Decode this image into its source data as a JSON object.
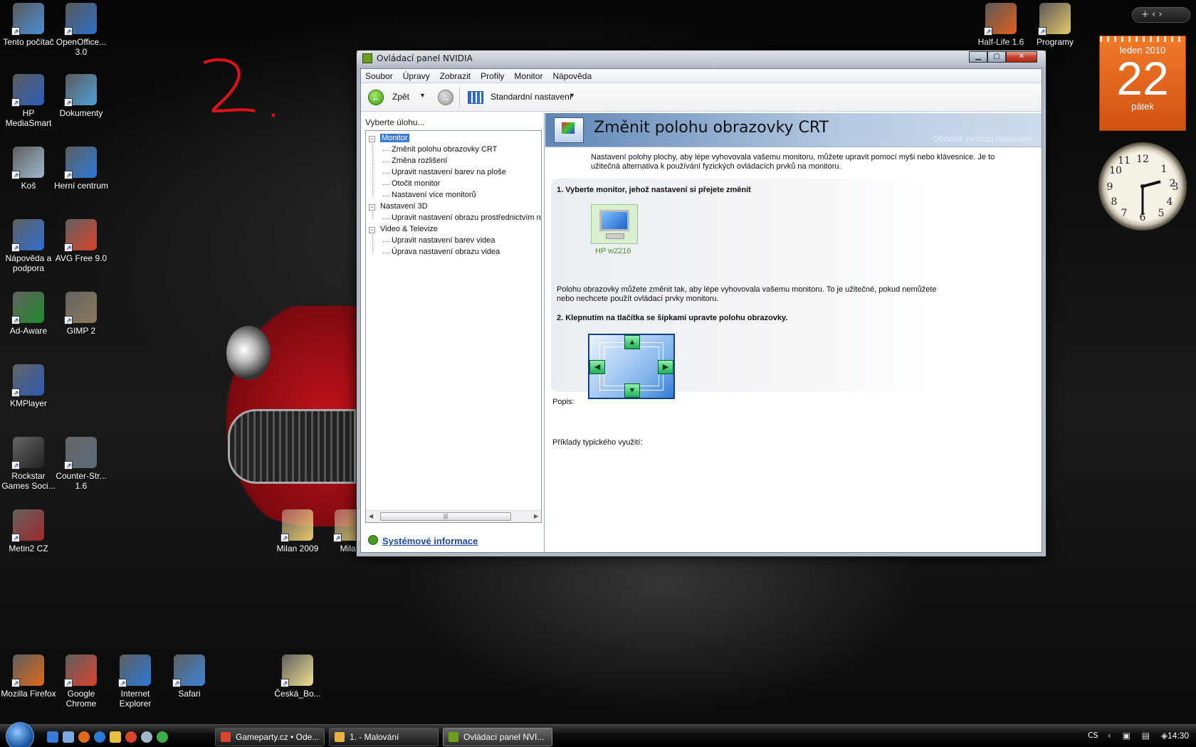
{
  "desktop": {
    "scribble_text": "2.",
    "icons_left": [
      {
        "label": "Tento počítač",
        "icon": "computer-icon",
        "color": "#4a8fd8"
      },
      {
        "label": "OpenOffice... 3.0",
        "icon": "openoffice-icon",
        "color": "#2f6fc4"
      },
      {
        "label": "HP MediaSmart",
        "icon": "hp-mediasmart-icon",
        "color": "#2a5fbf"
      },
      {
        "label": "Dokumenty",
        "icon": "documents-icon",
        "color": "#4fa0d8"
      },
      {
        "label": "Koš",
        "icon": "recycle-bin-icon",
        "color": "#9fb8cc"
      },
      {
        "label": "Herní centrum",
        "icon": "internet-explorer-icon",
        "color": "#2b79d6"
      },
      {
        "label": "Nápověda a podpora",
        "icon": "help-icon",
        "color": "#2f6fd0"
      },
      {
        "label": "AVG Free 9.0",
        "icon": "avg-icon",
        "color": "#d8412a"
      },
      {
        "label": "Ad-Aware",
        "icon": "ad-aware-icon",
        "color": "#1e8a2a"
      },
      {
        "label": "GIMP 2",
        "icon": "gimp-icon",
        "color": "#8a7a5a"
      },
      {
        "label": "KMPlayer",
        "icon": "kmplayer-icon",
        "color": "#2a5ab0"
      },
      {
        "label": "Rockstar Games Soci...",
        "icon": "rockstar-icon",
        "color": "#222222"
      },
      {
        "label": "Counter-Str... 1.6",
        "icon": "counter-strike-icon",
        "color": "#5a6a7a"
      },
      {
        "label": "Metin2 CZ",
        "icon": "metin2-icon",
        "color": "#a0282a"
      },
      {
        "label": "Milan 2009",
        "icon": "folder-icon",
        "color": "#e8c86a"
      },
      {
        "label": "Milan",
        "icon": "folder-icon",
        "color": "#e8c86a"
      },
      {
        "label": "Mozilla Firefox",
        "icon": "firefox-icon",
        "color": "#e06a1a"
      },
      {
        "label": "Google Chrome",
        "icon": "chrome-icon",
        "color": "#d9442f"
      },
      {
        "label": "Internet Explorer",
        "icon": "internet-explorer-icon",
        "color": "#2b79d6"
      },
      {
        "label": "Safari",
        "icon": "safari-icon",
        "color": "#3d86d8"
      },
      {
        "label": "Česká_Bo...",
        "icon": "file-icon",
        "color": "#f0e090"
      }
    ],
    "icons_right": [
      {
        "label": "Half-Life 1.6",
        "icon": "half-life-icon",
        "color": "#e0601a"
      },
      {
        "label": "Programy",
        "icon": "folder-icon",
        "color": "#e8c86a"
      }
    ]
  },
  "gadgets": {
    "sidebar_controls": "+  ‹ ›",
    "calendar": {
      "month": "leden 2010",
      "day": "22",
      "weekday": "pátek"
    },
    "clock": {
      "hours": 2,
      "minutes": 30
    }
  },
  "window": {
    "title": "Ovládací panel NVIDIA",
    "menu": [
      "Soubor",
      "Úpravy",
      "Zobrazit",
      "Profily",
      "Monitor",
      "Nápověda"
    ],
    "toolbar": {
      "back_label": "Zpět",
      "view_label": "Standardní nastavení"
    },
    "task_pane": {
      "title": "Vyberte úlohu...",
      "groups": [
        {
          "label": "Monitor",
          "items": [
            "Změnit polohu obrazovky CRT",
            "Změna rozlišení",
            "Upravit nastavení barev na ploše",
            "Otočit monitor",
            "Nastavení více monitorů"
          ]
        },
        {
          "label": "Nastavení 3D",
          "items": [
            "Upravit nastavení obrazu prostřednictvím n"
          ]
        },
        {
          "label": "Video & Televize",
          "items": [
            "Upravit nastavení barev videa",
            "Úprava nastavení obrazu videa"
          ]
        }
      ],
      "system_info": "Systémové informace"
    },
    "content": {
      "title": "Změnit polohu obrazovky CRT",
      "restore_defaults": "Obnovit výchozí nastavení",
      "intro": "Nastavení polohy plochy, aby lépe vyhovovala vašemu monitoru, můžete upravit pomocí myši nebo klávesnice. Je to užitečná alternativa k používání fyzických ovládacích prvků na monitoru.",
      "step1": "1. Vyberte monitor, jehož nastavení si přejete změnit",
      "monitor_name": "HP w2216",
      "position_text": "Polohu obrazovky můžete změnit tak, aby lépe vyhovovala vašemu monitoru. To je užitečné, pokud nemůžete nebo nechcete použít ovládací prvky monitoru.",
      "step2": "2. Klepnutím na tlačítka se šipkami upravte polohu obrazovky.",
      "description_label": "Popis:",
      "usage_label": "Příklady typického využití:"
    }
  },
  "taskbar": {
    "tasks": [
      {
        "label": "Gameparty.cz • Ode...",
        "color": "#d9442f"
      },
      {
        "label": "1. - Malování",
        "color": "#e6b24a"
      },
      {
        "label": "Ovládací panel NVI...",
        "color": "#6c9d1f"
      }
    ],
    "language": "CS",
    "time": "14:30"
  }
}
